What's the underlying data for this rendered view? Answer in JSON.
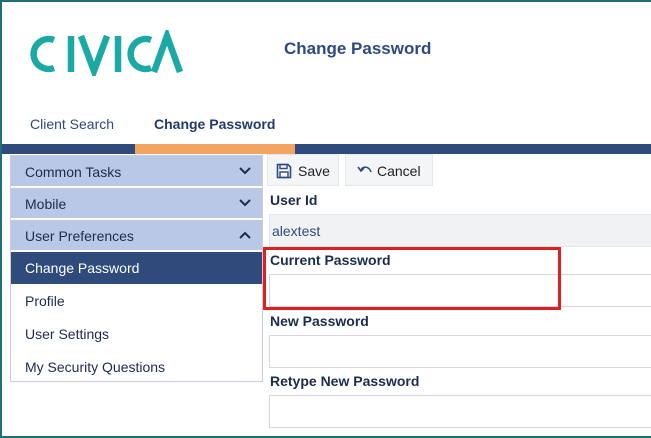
{
  "brand": {
    "logo_text": "CIVICA",
    "logo_color": "#1aa9a4"
  },
  "header": {
    "title": "Change Password"
  },
  "topnav": {
    "tabs": [
      {
        "label": "Client Search",
        "active": false
      },
      {
        "label": "Change Password",
        "active": true
      }
    ],
    "bar_color": "#2f4b7c",
    "accent_color": "#f3a460"
  },
  "sidebar": {
    "sections": [
      {
        "label": "Common Tasks",
        "icon": "chevron-down-icon",
        "expanded": false
      },
      {
        "label": "Mobile",
        "icon": "chevron-down-icon",
        "expanded": false
      },
      {
        "label": "User Preferences",
        "icon": "chevron-up-icon",
        "expanded": true
      }
    ],
    "items": [
      {
        "label": "Change Password",
        "active": true
      },
      {
        "label": "Profile",
        "active": false
      },
      {
        "label": "User Settings",
        "active": false
      },
      {
        "label": "My Security Questions",
        "active": false
      }
    ]
  },
  "toolbar": {
    "save_label": "Save",
    "save_icon": "floppy-disk-icon",
    "cancel_label": "Cancel",
    "cancel_icon": "undo-arrow-icon"
  },
  "form": {
    "user_id": {
      "label": "User Id",
      "value": "alextest"
    },
    "current_password": {
      "label": "Current Password",
      "value": ""
    },
    "new_password": {
      "label": "New Password",
      "value": ""
    },
    "retype_password": {
      "label": "Retype New Password",
      "value": ""
    }
  },
  "highlight_color": "#e02020"
}
